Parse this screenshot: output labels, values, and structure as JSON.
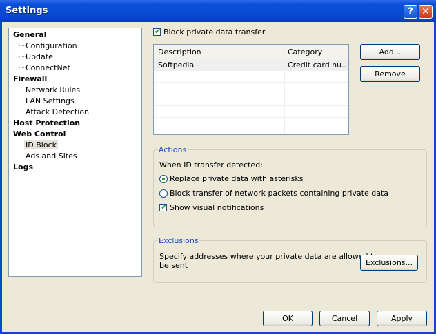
{
  "window": {
    "title": "Settings",
    "help_glyph": "?",
    "close_glyph": "✕"
  },
  "tree": {
    "general": {
      "label": "General",
      "children": [
        "Configuration",
        "Update",
        "ConnectNet"
      ]
    },
    "firewall": {
      "label": "Firewall",
      "children": [
        "Network Rules",
        "LAN Settings",
        "Attack Detection"
      ]
    },
    "host_protection": {
      "label": "Host Protection"
    },
    "web_control": {
      "label": "Web Control",
      "children": [
        "ID Block",
        "Ads and Sites"
      ]
    },
    "logs": {
      "label": "Logs"
    },
    "selected": "ID Block"
  },
  "block_private": {
    "label": "Block private data transfer",
    "checked": true
  },
  "table": {
    "columns": [
      "Description",
      "Category"
    ],
    "rows": [
      {
        "description": "Softpedia",
        "category": "Credit card nu..."
      }
    ]
  },
  "buttons": {
    "add": "Add...",
    "remove": "Remove",
    "exclusions": "Exclusions...",
    "ok": "OK",
    "cancel": "Cancel",
    "apply": "Apply"
  },
  "actions": {
    "title": "Actions",
    "when_label": "When ID transfer detected:",
    "option_replace": "Replace private data with asterisks",
    "option_block": "Block transfer of network packets containing private data",
    "selected_option": "replace",
    "show_notifications": {
      "label": "Show visual notifications",
      "checked": true
    }
  },
  "exclusions": {
    "title": "Exclusions",
    "text_line1": "Specify addresses where your private data are allowed to",
    "text_line2": "be sent"
  },
  "colors": {
    "title_bar": "#0A48CF",
    "window_bg": "#ECE9D8",
    "group_title": "#1F4DBD",
    "check_mark": "#21A121"
  }
}
